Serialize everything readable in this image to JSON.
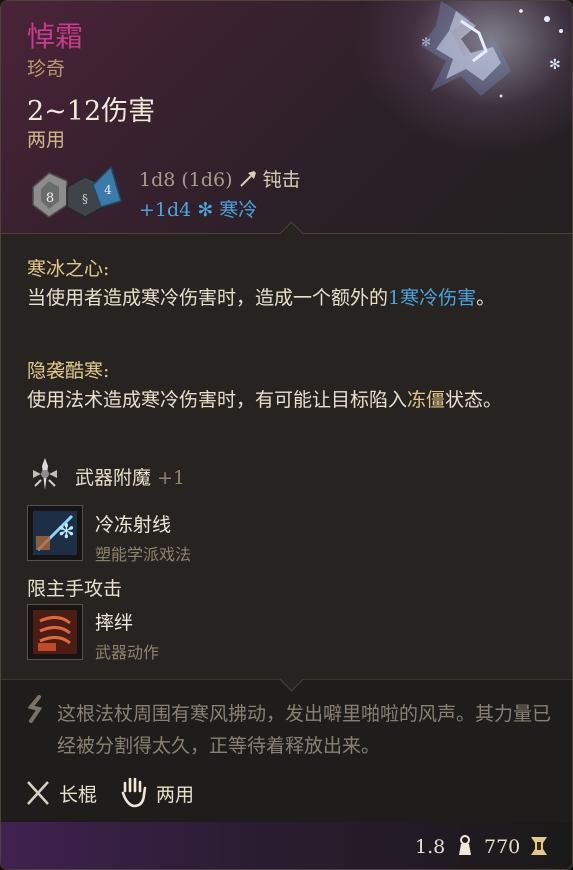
{
  "item": {
    "name": "悼霜",
    "rarity": "珍奇",
    "damage_range": "2~12伤害",
    "handedness": "两用",
    "damage_dice": "1d8 (1d6)",
    "damage_type": "钝击",
    "bonus_damage": "+1d4",
    "bonus_type": "寒冷",
    "die_faces": [
      "8",
      "4"
    ]
  },
  "traits": [
    {
      "title": "寒冰之心:",
      "text_before": "当使用者造成寒冷伤害时，造成一个额外的",
      "highlight": "1寒冷伤害",
      "text_after": "。"
    },
    {
      "title": "隐袭酷寒:",
      "text_before": "使用法术造成寒冷伤害时，有可能让目标陷入",
      "highlight": "冻僵",
      "text_after": "状态。"
    }
  ],
  "enchantment": {
    "label": "武器附魔",
    "value": "+1",
    "icon": "sword-enchant-icon"
  },
  "spell": {
    "name": "冷冻射线",
    "school": "塑能学派戏法",
    "icon": "ray-of-frost-icon"
  },
  "main_hand_label": "限主手攻击",
  "action": {
    "name": "摔绊",
    "type": "武器动作",
    "icon": "topple-icon"
  },
  "flavor": "这根法杖周围有寒风拂动，发出噼里啪啦的风声。其力量已经被分割得太久，正等待着释放出来。",
  "proficiency": [
    {
      "label": "长棍",
      "icon": "crossed-staves-icon"
    },
    {
      "label": "两用",
      "icon": "hand-icon"
    }
  ],
  "stats": {
    "weight": "1.8",
    "value": "770"
  },
  "colors": {
    "name": "#c93a8e",
    "rarity": "#b89a72",
    "cold": "#4aa3dd",
    "gold_text": "#e2c98a"
  }
}
